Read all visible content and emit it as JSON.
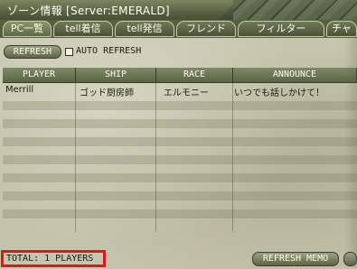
{
  "window": {
    "title": "ゾーン情報 [Server:EMERALD]"
  },
  "tabs": [
    {
      "label": "PC一覧",
      "active": true
    },
    {
      "label": "tell着信",
      "active": false
    },
    {
      "label": "tell発信",
      "active": false
    },
    {
      "label": "フレンド",
      "active": false
    },
    {
      "label": "フィルター",
      "active": false
    },
    {
      "label": "チャ",
      "active": false
    }
  ],
  "controls": {
    "refresh_label": "REFRESH",
    "auto_refresh_label": "AUTO REFRESH",
    "auto_refresh_checked": false
  },
  "table": {
    "columns": [
      "PLAYER",
      "SHIP",
      "RACE",
      "ANNOUNCE"
    ],
    "rows": [
      {
        "player": "Merrill",
        "ship": "ゴッド厨房師",
        "race": "エルモニー",
        "announce": "いつでも話しかけて！"
      }
    ]
  },
  "footer": {
    "total_text": "TOTAL:   1 PLAYERS",
    "refresh_memo_label": "REFRESH MEMO"
  },
  "colors": {
    "accent_red": "#e8131a",
    "header_olive": "#5a6445"
  }
}
